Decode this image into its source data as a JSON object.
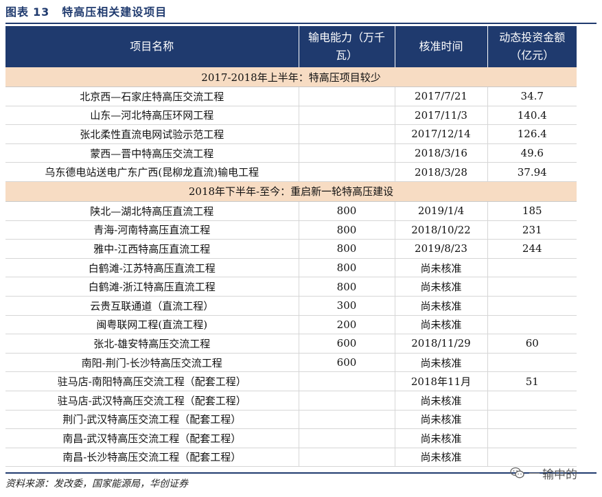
{
  "figure": {
    "label": "图表",
    "number": "13",
    "title": "特高压相关建设项目"
  },
  "table": {
    "headers": [
      "项目名称",
      "输电能力（万千瓦）",
      "核准时间",
      "动态投资金额（亿元）"
    ],
    "sections": [
      {
        "title": "2017-2018年上半年：特高压项目较少",
        "rows": [
          [
            "北京西—石家庄特高压交流工程",
            "",
            "2017/7/21",
            "34.7"
          ],
          [
            "山东—河北特高压环网工程",
            "",
            "2017/11/3",
            "140.4"
          ],
          [
            "张北柔性直流电网试验示范工程",
            "",
            "2017/12/14",
            "126.4"
          ],
          [
            "蒙西—晋中特高压交流工程",
            "",
            "2018/3/16",
            "49.6"
          ],
          [
            "乌东德电站送电广东广西(昆柳龙直流)输电工程",
            "",
            "2018/3/28",
            "37.94"
          ]
        ]
      },
      {
        "title": "2018年下半年-至今：重启新一轮特高压建设",
        "rows": [
          [
            "陕北—湖北特高压直流工程",
            "800",
            "2019/1/4",
            "185"
          ],
          [
            "青海-河南特高压直流工程",
            "800",
            "2018/10/22",
            "231"
          ],
          [
            "雅中-江西特高压直流工程",
            "800",
            "2019/8/23",
            "244"
          ],
          [
            "白鹤滩-江苏特高压直流工程",
            "800",
            "尚未核准",
            ""
          ],
          [
            "白鹤滩-浙江特高压直流工程",
            "800",
            "尚未核准",
            ""
          ],
          [
            "云贵互联通道（直流工程）",
            "300",
            "尚未核准",
            ""
          ],
          [
            "闽粤联网工程(直流工程)",
            "200",
            "尚未核准",
            ""
          ],
          [
            "张北-雄安特高压交流工程",
            "600",
            "2018/11/29",
            "60"
          ],
          [
            "南阳-荆门-长沙特高压交流工程",
            "600",
            "尚未核准",
            ""
          ],
          [
            "驻马店-南阳特高压交流工程（配套工程）",
            "",
            "2018年11月",
            "51"
          ],
          [
            "驻马店-武汉特高压交流工程（配套工程）",
            "",
            "尚未核准",
            ""
          ],
          [
            "荆门-武汉特高压交流工程（配套工程）",
            "",
            "尚未核准",
            ""
          ],
          [
            "南昌-武汉特高压交流工程（配套工程）",
            "",
            "尚未核准",
            ""
          ],
          [
            "南昌-长沙特高压交流工程（配套工程）",
            "",
            "尚未核准",
            ""
          ]
        ]
      }
    ]
  },
  "source": "资料来源：发改委，国家能源局，华创证券",
  "watermark": {
    "icon": "wechat-icon",
    "text": "输中的"
  },
  "colors": {
    "header_bg": "#1f3a6e",
    "section_bg": "#f7dcc3",
    "title_color": "#1f3a6e"
  }
}
